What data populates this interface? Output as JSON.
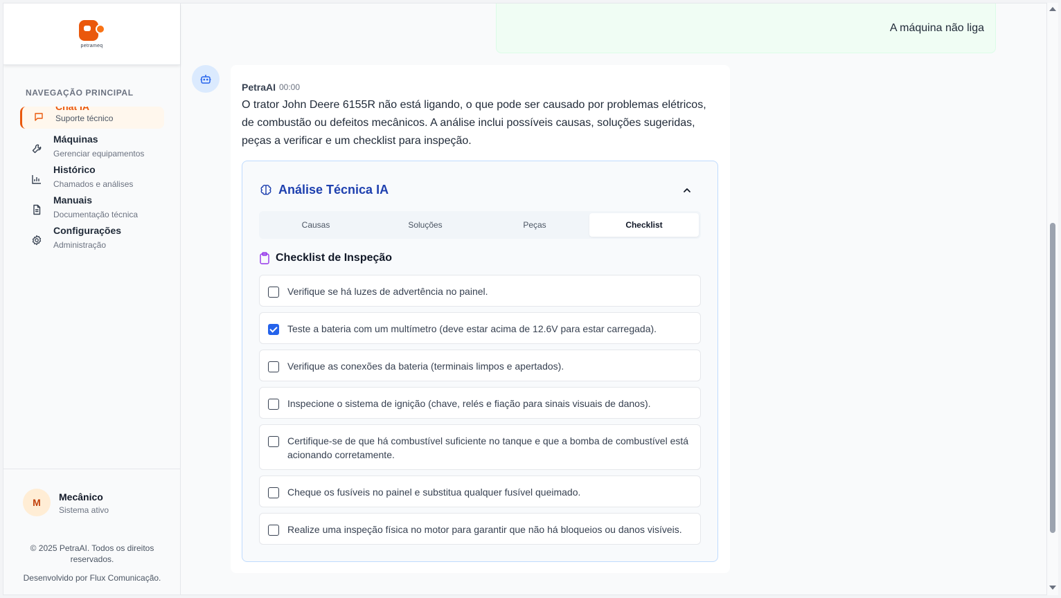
{
  "brand": {
    "logo_text": "petrameq"
  },
  "sidebar": {
    "nav_title": "NAVEGAÇÃO PRINCIPAL",
    "items": [
      {
        "label": "Chat IA",
        "sub": "Suporte técnico",
        "icon": "chat-icon"
      },
      {
        "label": "Máquinas",
        "sub": "Gerenciar equipamentos",
        "icon": "wrench-icon"
      },
      {
        "label": "Histórico",
        "sub": "Chamados e análises",
        "icon": "chart-icon"
      },
      {
        "label": "Manuais",
        "sub": "Documentação técnica",
        "icon": "document-icon"
      },
      {
        "label": "Configurações",
        "sub": "Administração",
        "icon": "gear-icon"
      }
    ],
    "user": {
      "initial": "M",
      "name": "Mecânico",
      "status": "Sistema ativo"
    },
    "copyright": "© 2025 PetraAI. Todos os direitos reservados.",
    "developer": "Desenvolvido por Flux Comunicação."
  },
  "chat": {
    "user_message": "A máquina não liga",
    "bot": {
      "name": "PetraAI",
      "time": "00:00",
      "text": "O trator John Deere 6155R não está ligando, o que pode ser causado por problemas elétricos, de combustão ou defeitos mecânicos. A análise inclui possíveis causas, soluções sugeridas, peças a verificar e um checklist para inspeção."
    }
  },
  "analysis": {
    "title": "Análise Técnica IA",
    "tabs": [
      "Causas",
      "Soluções",
      "Peças",
      "Checklist"
    ],
    "active_tab": "Checklist",
    "checklist_title": "Checklist de Inspeção",
    "items": [
      {
        "text": "Verifique se há luzes de advertência no painel.",
        "checked": false
      },
      {
        "text": "Teste a bateria com um multímetro (deve estar acima de 12.6V para estar carregada).",
        "checked": true
      },
      {
        "text": "Verifique as conexões da bateria (terminais limpos e apertados).",
        "checked": false
      },
      {
        "text": "Inspecione o sistema de ignição (chave, relés e fiação para sinais visuais de danos).",
        "checked": false
      },
      {
        "text": "Certifique-se de que há combustível suficiente no tanque e que a bomba de combustível está acionando corretamente.",
        "checked": false
      },
      {
        "text": "Cheque os fusíveis no painel e substitua qualquer fusível queimado.",
        "checked": false
      },
      {
        "text": "Realize uma inspeção física no motor para garantir que não há bloqueios ou danos visíveis.",
        "checked": false
      }
    ]
  },
  "colors": {
    "accent": "#ea580c",
    "primary": "#2563eb",
    "title_blue": "#1e40af",
    "user_bubble": "#f0fdf4"
  }
}
